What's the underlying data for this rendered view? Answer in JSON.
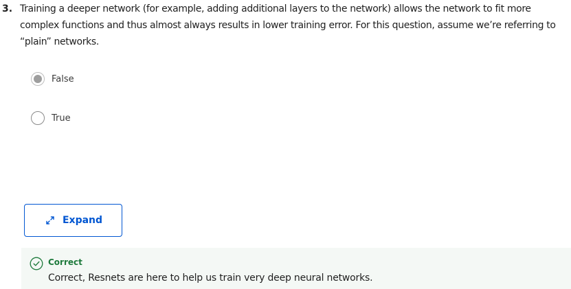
{
  "question": {
    "number": "3.",
    "text": "Training a deeper network (for example, adding additional layers to the network) allows the network to fit more complex functions and thus almost always results in lower training error. For this question, assume we’re referring to “plain” networks."
  },
  "options": [
    {
      "label": "False",
      "selected": true
    },
    {
      "label": "True",
      "selected": false
    }
  ],
  "expand_button": {
    "label": "Expand",
    "icon": "expand-arrows-icon"
  },
  "feedback": {
    "status": "Correct",
    "message": "Correct, Resnets are here to help us train very deep neural networks.",
    "icon": "check-circle-icon",
    "color": "#1e7a3c",
    "background": "#f4f8f5"
  },
  "colors": {
    "accent": "#0056d2",
    "text": "#1f1f1f"
  }
}
